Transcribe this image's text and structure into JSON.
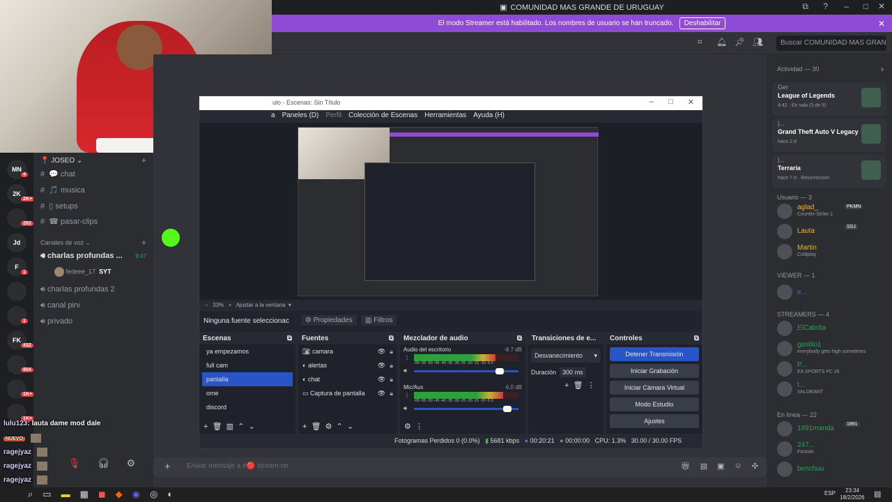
{
  "window": {
    "title": "COMUNIDAD MAS GRANDE DE URUGUAY"
  },
  "streamer_banner": {
    "text": "El modo Streamer está habilitado. Los nombres de usuario se han truncado.",
    "button": "Deshabilitar"
  },
  "search": {
    "placeholder": "Buscar COMUNIDAD MAS GRAN..."
  },
  "rail": {
    "servers": [
      {
        "abbr": "MN",
        "badge": "4"
      },
      {
        "abbr": "2K",
        "badge": "2K+"
      },
      {
        "abbr": "",
        "badge": "283"
      },
      {
        "abbr": "Jd",
        "badge": ""
      },
      {
        "abbr": "F",
        "badge": "1"
      },
      {
        "abbr": "",
        "badge": ""
      },
      {
        "abbr": "",
        "badge": "1"
      },
      {
        "abbr": "FK",
        "badge": "432"
      },
      {
        "abbr": "",
        "badge": "854"
      },
      {
        "abbr": "",
        "badge": "1K+"
      },
      {
        "abbr": "",
        "badge": "1K+"
      }
    ]
  },
  "channels": {
    "category": "JOSEO",
    "text": [
      "chat",
      "musica",
      "setups",
      "pasar-clips"
    ],
    "voice_category": "Canales de voz",
    "voice": [
      {
        "name": "charlas profundas ...",
        "time": "9:47"
      },
      {
        "name": "charlas profundas 2"
      },
      {
        "name": "canal pirv"
      },
      {
        "name": "privado"
      }
    ],
    "voice_user": "fedeee_17",
    "voice_user_tag": "SYT"
  },
  "chat_overlay": [
    {
      "user": "lulu123",
      "text": ": lauta dame mod dale"
    },
    {
      "user": "NUEVO",
      "text": ""
    },
    {
      "user": "ragejyaz",
      "text": ""
    },
    {
      "user": "ragejyaz",
      "text": ""
    },
    {
      "user": "ragejyaz",
      "text": ""
    },
    {
      "user": "ragejyaz",
      "text": ""
    }
  ],
  "message_input": {
    "placeholder": "Enviar mensaje a #🔴 stream-on"
  },
  "obs": {
    "title": "ulo - Escenas: Sin Título",
    "menu": [
      "a",
      "Paneles (D)",
      "Perfil",
      "Colección de Escenas",
      "Herramientas",
      "Ayuda (H)"
    ],
    "zoom": "33%",
    "zoom_fit": "Ajustar a la ventana",
    "no_source": "Ninguna fuente seleccionac",
    "properties": "Propiedades",
    "filters": "Filtros",
    "scenes_title": "Escenas",
    "scenes": [
      "ya empezamos",
      "full cam",
      "pantalla",
      "ome",
      "discord"
    ],
    "sources_title": "Fuentes",
    "sources": [
      "camara",
      "alertas",
      "chat",
      "Captura de pantalla"
    ],
    "mixer_title": "Mezclador de audio",
    "mixer": [
      {
        "name": "Audio del escritorio",
        "db": "-8.7 dB",
        "level": 0.78
      },
      {
        "name": "Mic/Aux",
        "db": "6.0 dB",
        "level": 0.85
      }
    ],
    "meter_ticks": "-60 -55 -50 -45 -40 -35 -30 -25 -20 -15 -10 -5 0",
    "transitions_title": "Transiciones de e...",
    "transition": "Desvanecimiento",
    "duration_label": "Duración",
    "duration": "300 ms",
    "controls_title": "Controles",
    "controls": [
      "Detener Transmisión",
      "Iniciar Grabación",
      "Iniciar Cámara Virtual",
      "Modo Estudio",
      "Ajustes"
    ],
    "status": {
      "dropped": "Fotogramas Perdidos 0 (0.0%)",
      "bitrate": "5681 kbps",
      "live": "00:20:21",
      "rec": "00:00:00",
      "cpu": "CPU: 1.3%",
      "fps": "30.00 / 30.00 FPS"
    }
  },
  "members": {
    "activity_header": "Actividad — 30",
    "activities": [
      {
        "user": "Ger",
        "game": "League of Legends",
        "detail": "4:42 · En sala (3 de 5)"
      },
      {
        "user": "|...",
        "game": "Grand Theft Auto V Legacy",
        "detail": "hace 2 d"
      },
      {
        "user": "|...",
        "game": "Terraria",
        "detail": "hace 7 d · Resurrección"
      }
    ],
    "usuario_header": "Usuario — 3",
    "usuarios": [
      {
        "name": "aglad_",
        "tag": "PKMN",
        "sub": "Counter-Strike 2",
        "color": "#f0b232"
      },
      {
        "name": "Lauta",
        "tag": "SSJ",
        "sub": "",
        "color": "#f0b232"
      },
      {
        "name": "Martin",
        "sub": "Coldplay",
        "color": "#f0b232"
      }
    ],
    "viewer_header": "VIEWER — 1",
    "viewer": "e...",
    "streamers_header": "STREAMERS — 4",
    "streamers": [
      {
        "name": "ElCabrita",
        "sub": ""
      },
      {
        "name": "gastilo1",
        "sub": "everybody gets high sometimes"
      },
      {
        "name": "P...",
        "sub": "EA SPORTS FC 26"
      },
      {
        "name": "t...",
        "sub": "VALORANT"
      }
    ],
    "online_header": "En línea — 22",
    "online": [
      {
        "name": "1891manda",
        "tag": "1891",
        "sub": ""
      },
      {
        "name": "247...",
        "sub": "Fortnite"
      },
      {
        "name": "benchuu",
        "sub": ""
      }
    ]
  },
  "taskbar": {
    "time": "23:34",
    "date": "18/2/2026",
    "lang": "ESP"
  }
}
